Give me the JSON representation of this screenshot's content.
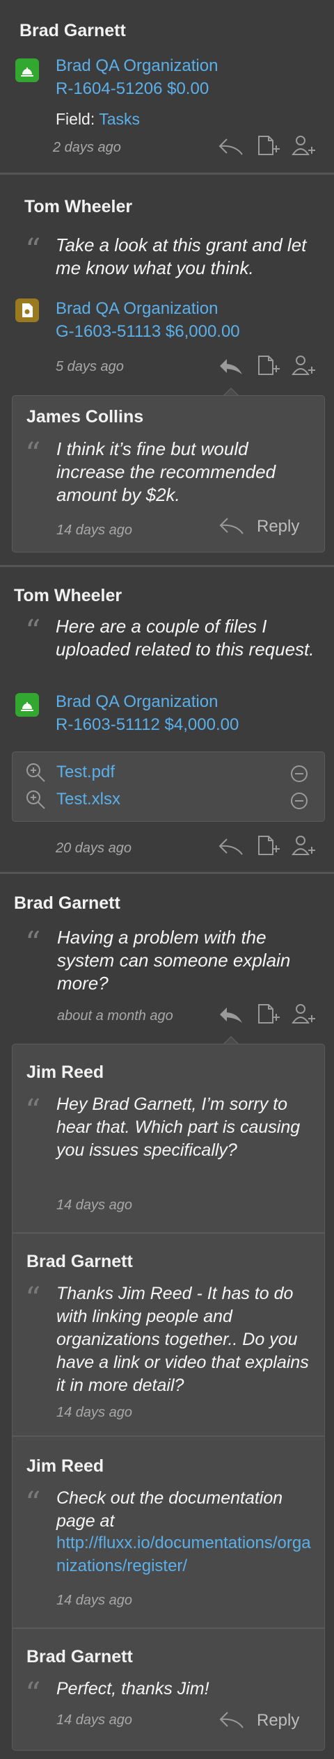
{
  "colors": {
    "background": "#3c3c3c",
    "panel": "#4a4a4a",
    "accent_link": "#5bb0ea",
    "request_icon": "#33a831",
    "grant_icon": "#9a7a1e"
  },
  "posts": [
    {
      "author": "Brad Garnett",
      "record": {
        "icon": "request-bell-icon",
        "line1": "Brad QA Organization",
        "line2": "R-1604-51206 $0.00"
      },
      "field_label": "Field:",
      "field_value": "Tasks",
      "time": "2 days ago"
    },
    {
      "author": "Tom Wheeler",
      "message": "Take a look at this grant and let me know what you think.",
      "record": {
        "icon": "grant-document-icon",
        "line1": "Brad QA Organization",
        "line2": "G-1603-51113 $6,000.00"
      },
      "time": "5 days ago",
      "replies": [
        {
          "author": "James Collins",
          "message": "I think it’s fine but would increase the recommended amount by $2k.",
          "time": "14 days ago",
          "reply_label": "Reply"
        }
      ]
    },
    {
      "author": "Tom Wheeler",
      "message": "Here are a couple of files I uploaded related to this request.",
      "record": {
        "icon": "request-bell-icon",
        "line1": "Brad QA Organization",
        "line2": "R-1603-51112 $4,000.00"
      },
      "files": [
        "Test.pdf",
        "Test.xlsx"
      ],
      "time": "20 days ago"
    },
    {
      "author": "Brad Garnett",
      "message": "Having a problem with the system can someone explain more?",
      "time": "about a month ago",
      "replies": [
        {
          "author": "Jim Reed",
          "message": "Hey Brad Garnett, I’m sorry to hear that.  Which part is causing you issues specifically?",
          "time": "14 days ago"
        },
        {
          "author": "Brad Garnett",
          "message": "Thanks Jim Reed - It has to do with linking people and organizations together.. Do you have a link or video that explains it in more detail?",
          "time": "14 days ago"
        },
        {
          "author": "Jim Reed",
          "message": "Check out the documentation page at",
          "link": "http://fluxx.io/documentations/organizations/register/",
          "time": "14 days ago"
        },
        {
          "author": "Brad Garnett",
          "message": "Perfect, thanks Jim!",
          "time": "14 days ago",
          "reply_label": "Reply"
        }
      ]
    }
  ]
}
